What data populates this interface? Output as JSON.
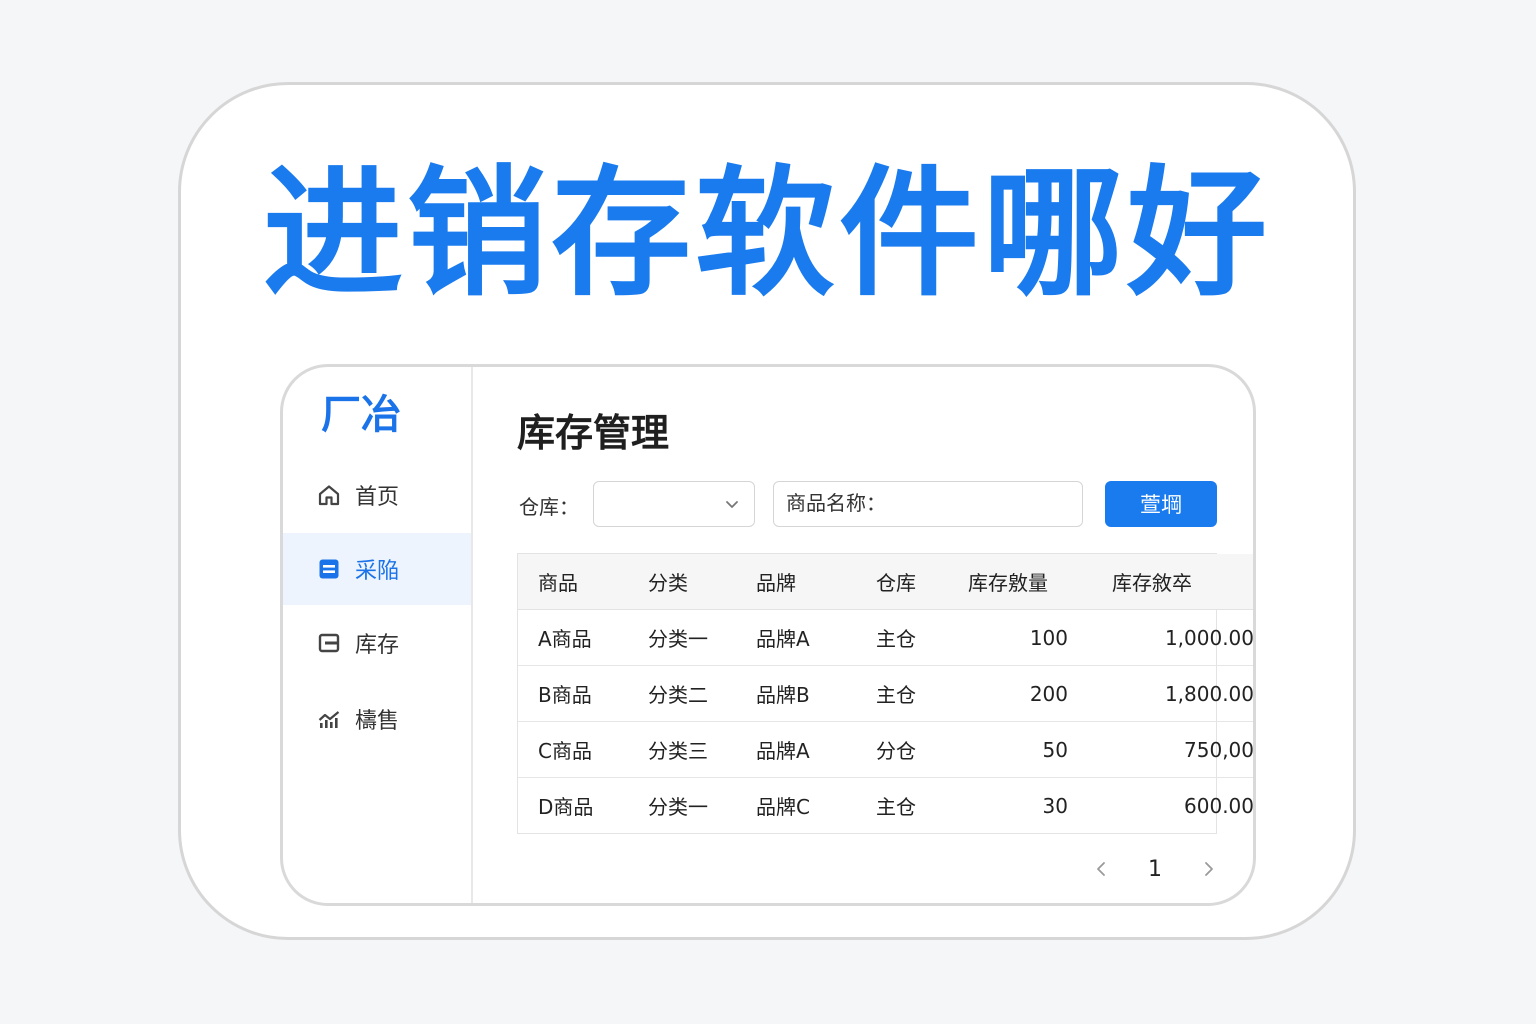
{
  "headline": "进销存软件哪好",
  "app": {
    "logo_text": "厂冶",
    "sidebar": {
      "items": [
        {
          "label": "首页",
          "icon": "home-icon",
          "active": false
        },
        {
          "label": "采陥",
          "icon": "purchase-list-icon",
          "active": true
        },
        {
          "label": "库存",
          "icon": "inventory-box-icon",
          "active": false
        },
        {
          "label": "檮售",
          "icon": "sales-chart-icon",
          "active": false
        }
      ]
    },
    "main": {
      "title": "库存管理",
      "filters": {
        "warehouse_label": "仓库：",
        "warehouse_value": "",
        "product_name_text": "商品名称：",
        "query_label": "萱堈"
      },
      "table": {
        "headers": [
          "商品",
          "分类",
          "品牌",
          "仓库",
          "库存敫量",
          "库存敘卒"
        ],
        "rows": [
          [
            "A商品",
            "分类一",
            "品牌A",
            "主仓",
            "100",
            "1,000.00"
          ],
          [
            "B商品",
            "分类二",
            "品牌B",
            "主仓",
            "200",
            "1,800.00"
          ],
          [
            "C商品",
            "分类三",
            "品牌A",
            "分仓",
            "50",
            "750,00"
          ],
          [
            "D商品",
            "分类一",
            "品牌C",
            "主仓",
            "30",
            "600.00"
          ]
        ]
      },
      "pagination": {
        "current_page": "1"
      }
    }
  },
  "colors": {
    "accent": "#1a7bef",
    "active_bg": "#eef4fd",
    "border": "#d9d9d9"
  }
}
